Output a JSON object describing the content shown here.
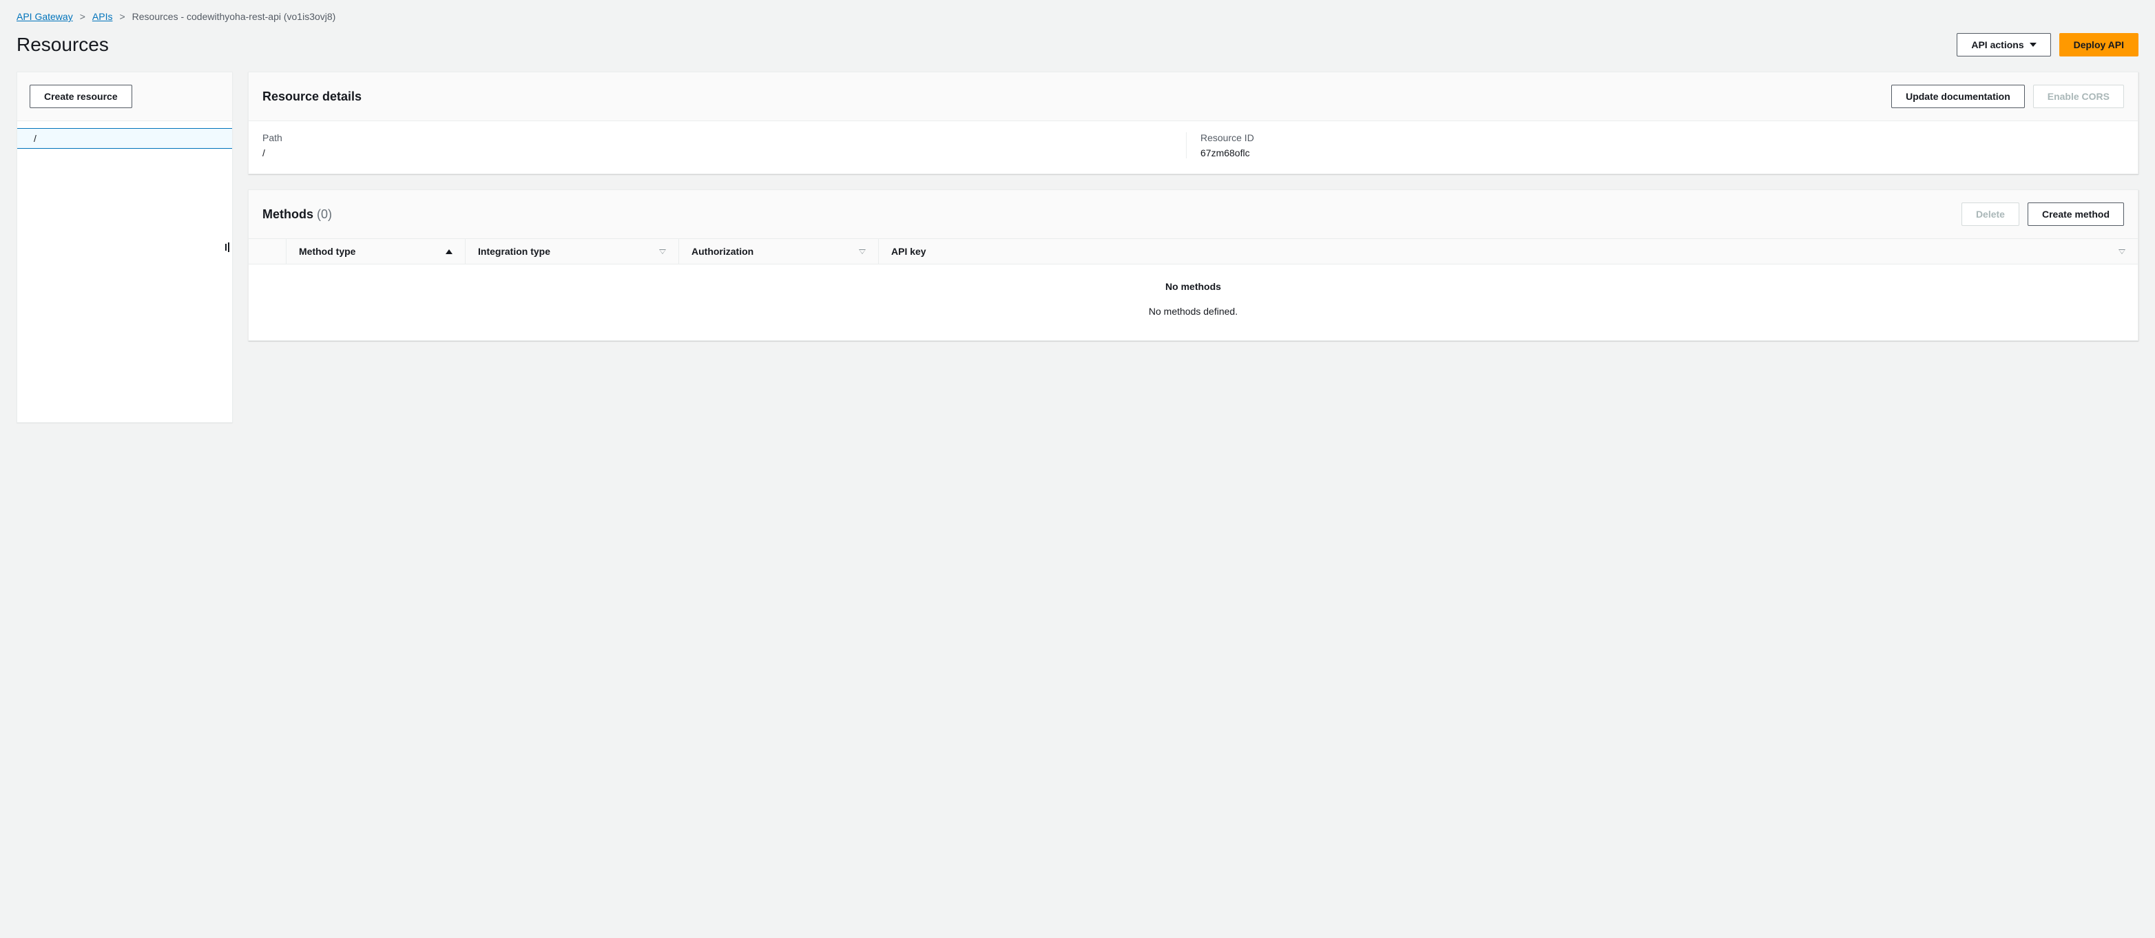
{
  "breadcrumb": {
    "items": [
      {
        "label": "API Gateway",
        "link": true
      },
      {
        "label": "APIs",
        "link": true
      },
      {
        "label": "Resources - codewithyoha-rest-api (vo1is3ovj8)",
        "link": false
      }
    ]
  },
  "page": {
    "title": "Resources"
  },
  "header_actions": {
    "api_actions": "API actions",
    "deploy": "Deploy API"
  },
  "tree": {
    "create_resource": "Create resource",
    "items": [
      {
        "label": "/",
        "selected": true
      }
    ]
  },
  "resource_details": {
    "title": "Resource details",
    "update_doc": "Update documentation",
    "enable_cors": "Enable CORS",
    "path_label": "Path",
    "path_value": "/",
    "resource_id_label": "Resource ID",
    "resource_id_value": "67zm68oflc"
  },
  "methods": {
    "title": "Methods",
    "count": "(0)",
    "delete": "Delete",
    "create": "Create method",
    "columns": {
      "method_type": "Method type",
      "integration_type": "Integration type",
      "authorization": "Authorization",
      "api_key": "API key"
    },
    "empty_title": "No methods",
    "empty_sub": "No methods defined."
  }
}
